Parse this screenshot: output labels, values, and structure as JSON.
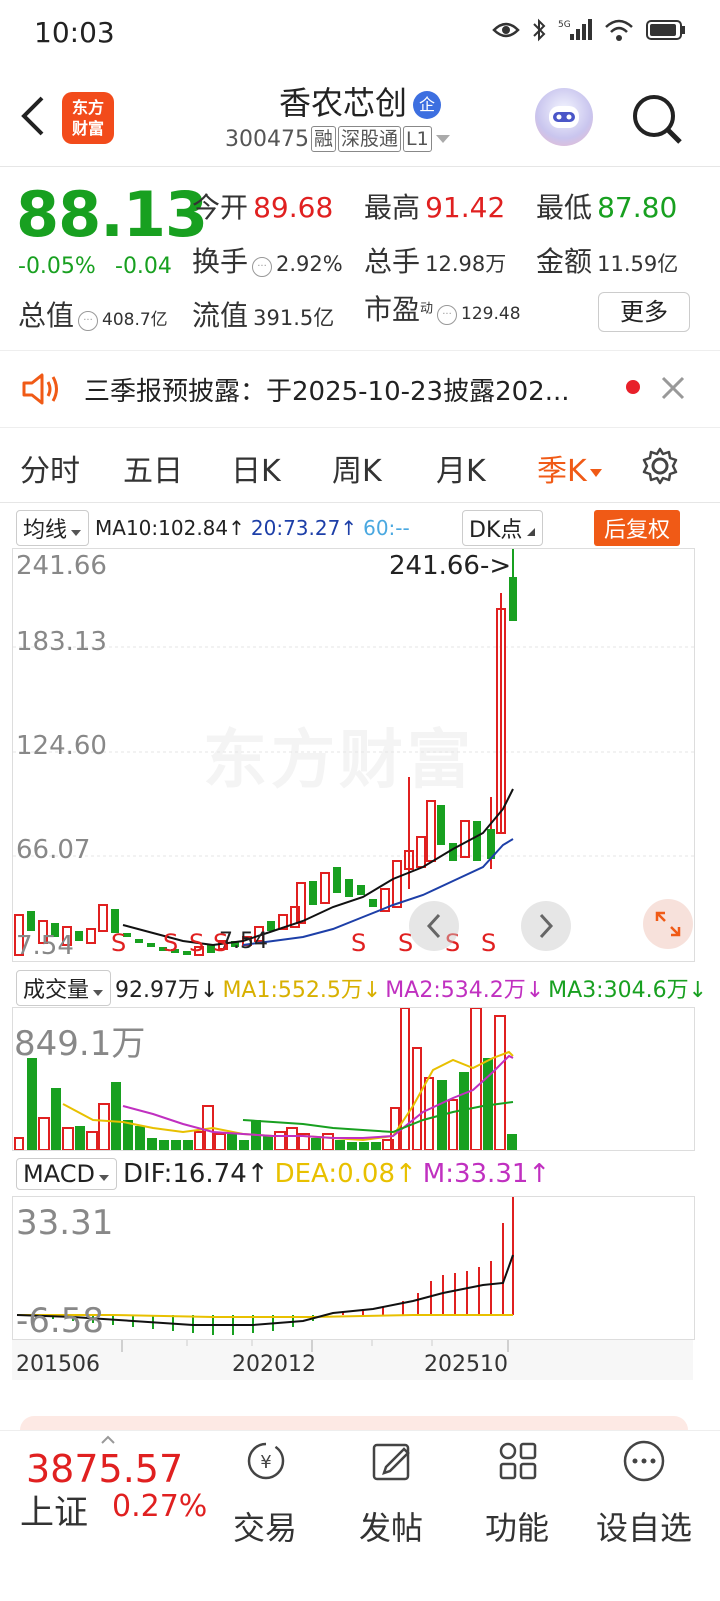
{
  "status_bar": {
    "time": "10:03"
  },
  "header": {
    "logo_text_line1": "东方",
    "logo_text_line2": "财富",
    "stock_name": "香农芯创",
    "name_badge": "企",
    "stock_code": "300475",
    "tags": [
      "融",
      "深股通",
      "L1"
    ]
  },
  "quote": {
    "price": "88.13",
    "change_pct": "-0.05%",
    "change": "-0.04",
    "open_label": "今开",
    "open": "89.68",
    "high_label": "最高",
    "high": "91.42",
    "low_label": "最低",
    "low": "87.80",
    "turnover_label": "换手",
    "turnover": "2.92%",
    "volume_label": "总手",
    "volume": "12.98万",
    "amount_label": "金额",
    "amount": "11.59亿",
    "mktcap_label": "总值",
    "mktcap": "408.7亿",
    "float_label": "流值",
    "float_cap": "391.5亿",
    "pe_label": "市盈",
    "pe_sup": "动",
    "pe": "129.48",
    "more_button": "更多"
  },
  "notice": {
    "text": "三季报预披露：于2025-10-23披露202..."
  },
  "tabs": [
    {
      "label": "分时"
    },
    {
      "label": "五日"
    },
    {
      "label": "日K"
    },
    {
      "label": "周K"
    },
    {
      "label": "月K"
    },
    {
      "label": "季K"
    }
  ],
  "chart_controls": {
    "ma_select": "均线",
    "ma10": "MA10:102.84↑",
    "ma20": "20:73.27↑",
    "ma60": "60:--",
    "dk_button": "DK点",
    "restore_button": "后复权"
  },
  "price_axis": [
    "241.66",
    "183.13",
    "124.60",
    "66.07",
    "7.54"
  ],
  "annotations": {
    "high_marker": "241.66->",
    "low_marker": "7.54",
    "signal": "S"
  },
  "watermark": "东方财富",
  "volume_panel": {
    "select": "成交量",
    "vol": "92.97万↓",
    "ma1": "MA1:552.5万↓",
    "ma2": "MA2:534.2万↓",
    "ma3": "MA3:304.6万↓",
    "axis_top": "849.1万"
  },
  "macd_panel": {
    "select": "MACD",
    "dif": "DIF:16.74↑",
    "dea": "DEA:0.08↑",
    "m": "M:33.31↑",
    "axis_top": "33.31",
    "axis_bottom": "-6.58"
  },
  "date_axis": [
    "201506",
    "202012",
    "202510"
  ],
  "colors": {
    "up": "#e02020",
    "down": "#18a020",
    "accent": "#f05a16",
    "ma_black": "#111111",
    "ma_blue": "#1d3fa8",
    "ma_yellow": "#e8c000",
    "ma_magenta": "#c030c0"
  },
  "bottom_bar": {
    "index_value": "3875.57",
    "index_name": "上证",
    "index_change": "0.27%",
    "nav": [
      {
        "label": "交易",
        "icon": "yen-exchange-icon"
      },
      {
        "label": "发帖",
        "icon": "edit-icon"
      },
      {
        "label": "功能",
        "icon": "grid-icon"
      },
      {
        "label": "设自选",
        "icon": "more-icon"
      }
    ]
  }
}
